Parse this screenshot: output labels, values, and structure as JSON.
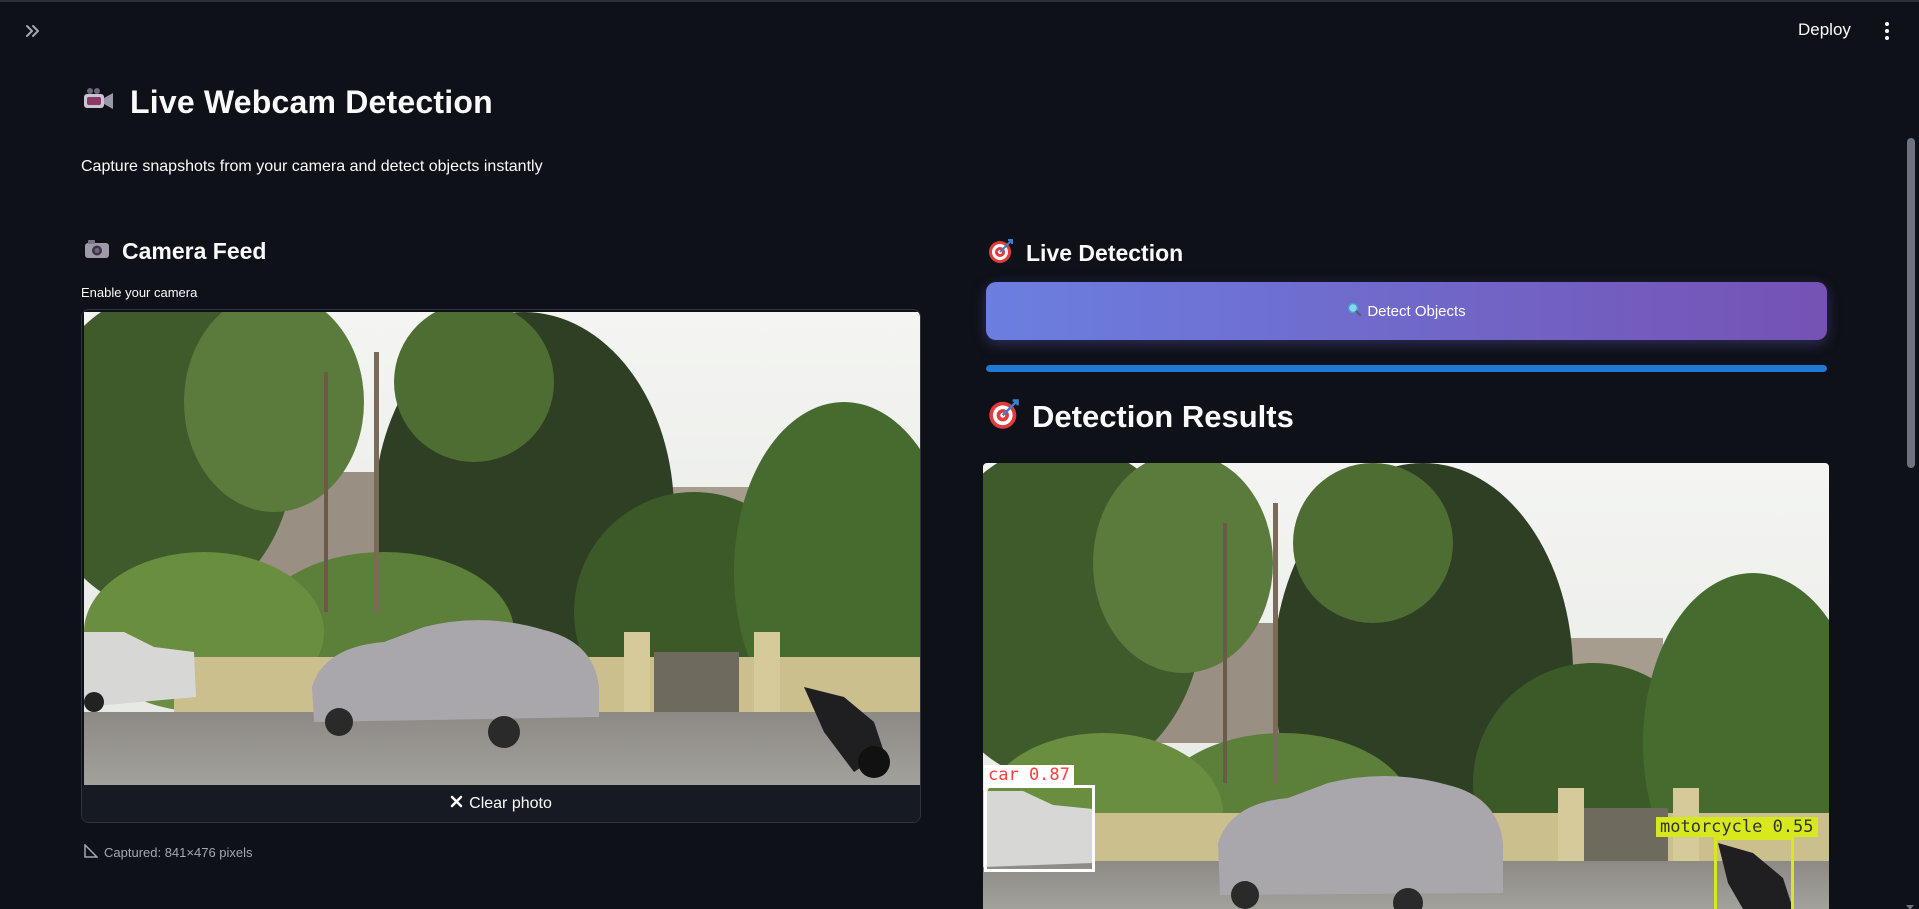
{
  "header": {
    "deploy_label": "Deploy"
  },
  "page": {
    "title": "Live Webcam Detection",
    "subtitle": "Capture snapshots from your camera and detect objects instantly"
  },
  "camera": {
    "heading": "Camera Feed",
    "label": "Enable your camera",
    "clear_label": "Clear photo",
    "captured_text": "Captured: 841×476 pixels"
  },
  "live": {
    "heading": "Live Detection",
    "detect_label": "Detect Objects",
    "progress": 1.0
  },
  "results": {
    "heading": "Detection Results",
    "detections": [
      {
        "label": "car 0.87",
        "color": "#ffffff"
      },
      {
        "label": "motorcycle 0.55",
        "color": "#d7e91c"
      }
    ]
  },
  "colors": {
    "background": "#0e1117",
    "accent_blue": "#1f7ad6",
    "button_gradient_start": "#6b7fe0",
    "button_gradient_end": "#7552b4"
  },
  "icons": {
    "expand": "double-chevron-right-icon",
    "menu": "kebab-menu-icon",
    "title": "video-camera-icon",
    "camera": "camera-icon",
    "live": "target-icon",
    "detect": "magnifier-icon",
    "clear": "close-icon",
    "captured": "ruler-triangle-icon"
  }
}
